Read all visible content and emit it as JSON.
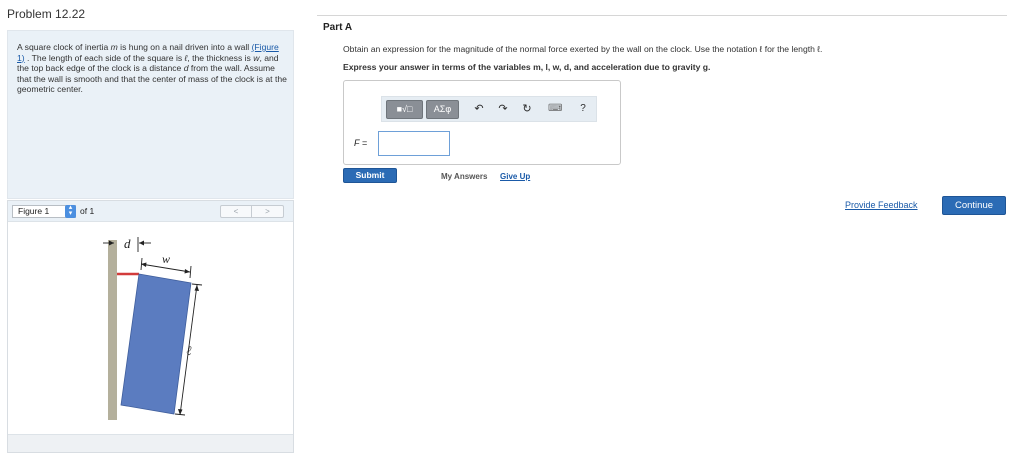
{
  "problem": {
    "title": "Problem 12.22",
    "text_1": "A square clock of inertia ",
    "var_m": "m",
    "text_2": " is hung on a nail driven into a wall",
    "figure_link": "(Figure 1)",
    "text_3": " . The length of each side of the square is ",
    "var_l": "ℓ",
    "text_4": ", the thickness is ",
    "var_w": "w",
    "text_5": ", and the top back edge of the clock is a distance ",
    "var_d": "d",
    "text_6": " from the wall. Assume that the wall is smooth and that the center of mass of the clock is at the geometric center."
  },
  "figure": {
    "select_value": "Figure 1",
    "of_text": "of 1",
    "prev_label": "<",
    "next_label": ">",
    "label_d": "d",
    "label_w": "w",
    "label_l": "ℓ",
    "colors": {
      "wall": "#b4b09c",
      "clock": "#5b7cc0",
      "nail": "#d23b3b"
    }
  },
  "part_a": {
    "title": "Part A",
    "question": "Obtain an expression for the magnitude of the normal force exerted by the wall on the clock. Use the notation ℓ for the length ℓ.",
    "instruction": "Express your answer in terms of the variables m, l, w, d, and acceleration due to gravity g.",
    "toolbar": {
      "templates_label": "■√□",
      "symbols_label": "ΑΣφ",
      "undo_icon": "↶",
      "redo_icon": "↷",
      "reset_icon": "↻",
      "keyboard_icon": "⌨",
      "help_icon": "?"
    },
    "answer_label": "F =",
    "answer_value": "",
    "submit_label": "Submit",
    "my_answers_label": "My Answers",
    "give_up_label": "Give Up"
  },
  "footer": {
    "feedback_label": "Provide Feedback",
    "continue_label": "Continue"
  }
}
